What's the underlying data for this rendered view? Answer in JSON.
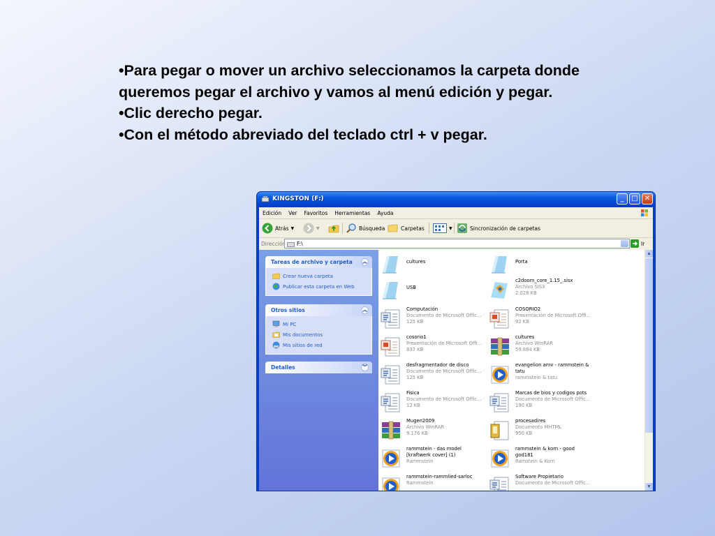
{
  "slide": {
    "lines": [
      "•Para pegar o mover un archivo seleccionamos la carpeta donde queremos pegar el archivo y vamos al menú edición y pegar.",
      "•Clic derecho pegar.",
      "•Con el método abreviado del teclado ctrl + v pegar."
    ]
  },
  "window": {
    "title": "KINGSTON (F:)",
    "menu": [
      "Edición",
      "Ver",
      "Favoritos",
      "Herramientas",
      "Ayuda"
    ],
    "toolbar": {
      "back": "Atrás",
      "search": "Búsqueda",
      "folders": "Carpetas",
      "sync": "Sincronización de carpetas"
    },
    "address": {
      "label": "Dirección",
      "value": "F:\\",
      "go": "Ir"
    },
    "left_panels": [
      {
        "title": "Tareas de archivo y carpeta",
        "items": [
          "Crear nueva carpeta",
          "Publicar esta carpeta en Web"
        ]
      },
      {
        "title": "Otros sitios",
        "items": [
          "Mi PC",
          "Mis documentos",
          "Mis sitios de red"
        ]
      },
      {
        "title": "Detalles",
        "items": []
      }
    ],
    "files": [
      {
        "name": "cultures",
        "type": "",
        "size": "",
        "icon": "folder-icon"
      },
      {
        "name": "Porta",
        "type": "",
        "size": "",
        "icon": "folder-icon"
      },
      {
        "name": "USB",
        "type": "",
        "size": "",
        "icon": "folder-icon"
      },
      {
        "name": "c2doom_core_1.15_.sisx",
        "type": "Archivo SISX",
        "size": "2.028 KB",
        "icon": "sisx-file-icon"
      },
      {
        "name": "Computación",
        "type": "Documento de Microsoft Offic...",
        "size": "125 KB",
        "icon": "word-document-icon"
      },
      {
        "name": "COSORIO2",
        "type": "Presentación de Microsoft Offi...",
        "size": "92 KB",
        "icon": "powerpoint-icon"
      },
      {
        "name": "cosorio1",
        "type": "Presentación de Microsoft Offi...",
        "size": "837 KB",
        "icon": "powerpoint-icon"
      },
      {
        "name": "cultures",
        "type": "Archivo WinRAR",
        "size": "59.884 KB",
        "icon": "winrar-icon"
      },
      {
        "name": "desfragmentador de disco",
        "type": "Documento de Microsoft Offic...",
        "size": "125 KB",
        "icon": "word-document-icon"
      },
      {
        "name": "evangelion amv - rammstein & tatu",
        "type": "rammstein & tatu",
        "size": "",
        "icon": "media-player-icon"
      },
      {
        "name": "Fisica",
        "type": "Documento de Microsoft Offic...",
        "size": "12 KB",
        "icon": "word-document-icon"
      },
      {
        "name": "Marcas de bios y codigos pots",
        "type": "Documento de Microsoft Offic...",
        "size": "190 KB",
        "icon": "word-document-icon"
      },
      {
        "name": "Mugen2009",
        "type": "Archivo WinRAR",
        "size": "9.176 KB",
        "icon": "winrar-icon"
      },
      {
        "name": "procesadires",
        "type": "Documento MHTML",
        "size": "950 KB",
        "icon": "mhtml-icon"
      },
      {
        "name": "rammstein - das model [kraftwerk cover] (1)",
        "type": "Rammstein",
        "size": "",
        "icon": "media-player-icon"
      },
      {
        "name": "rammstein & korn - good god181",
        "type": "Ramstein & Korn",
        "size": "",
        "icon": "media-player-icon"
      },
      {
        "name": "rammstein-rammlied-sarloc",
        "type": "Rammstein",
        "size": "",
        "icon": "media-player-icon"
      },
      {
        "name": "Software Propietario",
        "type": "Documento de Microsoft Offic...",
        "size": "",
        "icon": "word-document-icon"
      }
    ]
  }
}
